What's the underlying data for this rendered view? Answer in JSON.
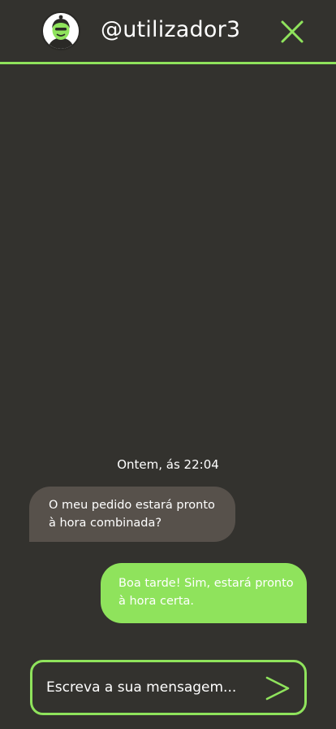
{
  "header": {
    "username": "@utilizador3",
    "avatar_icon": "user-avatar-icon",
    "close_icon": "close-icon",
    "accent_color": "#8fe35c"
  },
  "conversation": {
    "timestamp": "Ontem, ás 22:04",
    "messages": [
      {
        "direction": "incoming",
        "lines": [
          "O meu pedido estará pronto",
          "à hora combinada?"
        ],
        "color": "#57514b"
      },
      {
        "direction": "outgoing",
        "lines": [
          "Boa tarde! Sim, estará pronto",
          "à hora certa."
        ],
        "color": "#8fe35c"
      }
    ]
  },
  "composer": {
    "placeholder": "Escreva a sua mensagem...",
    "value": "",
    "send_icon": "send-arrow-icon"
  },
  "colors": {
    "background": "#33322e",
    "accent": "#8fe35c",
    "incoming_bubble": "#57514b"
  }
}
